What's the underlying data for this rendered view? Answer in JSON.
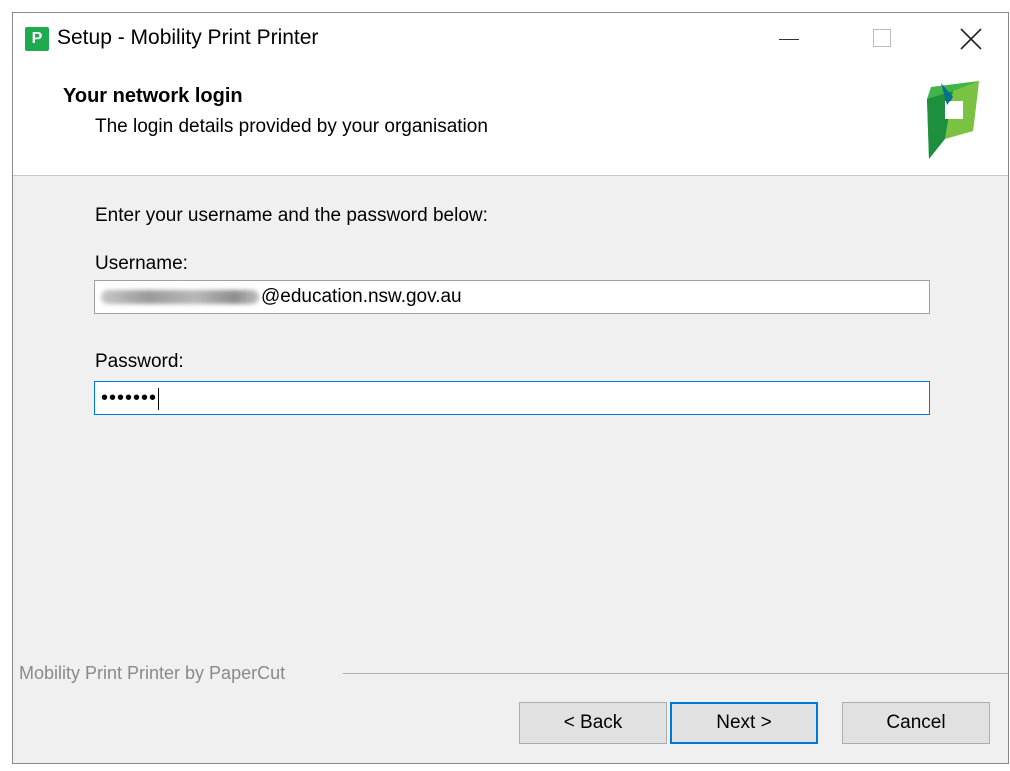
{
  "window": {
    "title": "Setup - Mobility Print Printer",
    "app_icon_letter": "P",
    "icon_names": [
      "app-icon",
      "minimize-icon",
      "maximize-icon",
      "close-icon",
      "papercut-logo-icon"
    ],
    "accent_color": "#0078d7",
    "brand_color": "#1faa4f"
  },
  "header": {
    "title": "Your network login",
    "subtitle": "The login details provided by your organisation"
  },
  "form": {
    "instruction": "Enter your username and the password below:",
    "username_label": "Username:",
    "username_value_visible": "@education.nsw.gov.au",
    "password_label": "Password:",
    "password_value_masked": "•••••••"
  },
  "footer": {
    "brand_text": "Mobility Print Printer by PaperCut"
  },
  "buttons": {
    "back": "< Back",
    "next": "Next >",
    "cancel": "Cancel"
  }
}
